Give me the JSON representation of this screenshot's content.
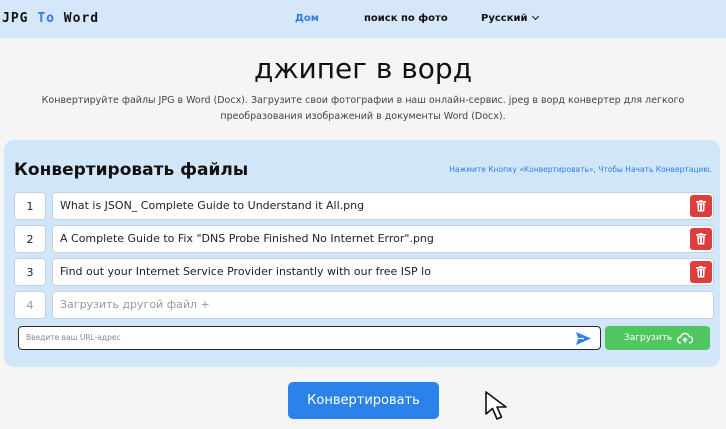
{
  "nav": {
    "logo_main": "JPG ",
    "logo_to": "To",
    "logo_end": " Word",
    "links": [
      {
        "label": "Дом"
      },
      {
        "label": "поиск по фото"
      },
      {
        "label": "Русский"
      }
    ]
  },
  "hero": {
    "title": "джипег в ворд",
    "description": "Конвертируйте файлы JPG в Word (Docx). Загрузите свои фотографии в наш онлайн-сервис. jpeg в ворд конвертер для легкого преобразования изображений в документы Word (Docx)."
  },
  "converter": {
    "title": "Конвертировать файлы",
    "hint": "Нажмите Кнопку «Конвертировать», Чтобы Начать Конвертацию.",
    "files": [
      {
        "num": "1",
        "name": "What is JSON_ Complete Guide to Understand it All.png"
      },
      {
        "num": "2",
        "name": "A Complete Guide to Fix \"DNS Probe Finished No Internet Error\".png"
      },
      {
        "num": "3",
        "name": "Find out your Internet Service Provider instantly with our free ISP lo"
      }
    ],
    "add_row": {
      "num": "4",
      "label": "Загрузить другой файл +"
    },
    "url_placeholder": "Введите ваш URL-адрес",
    "upload_label": "Загрузить",
    "convert_label": "Конвертировать"
  },
  "colors": {
    "accent": "#2b83ea",
    "nav_bg": "#d6e7fa",
    "panel_bg": "#d2e6f9",
    "delete": "#dc3e3e",
    "upload": "#4fc660"
  }
}
